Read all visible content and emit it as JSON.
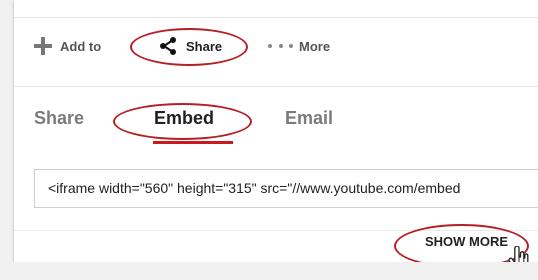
{
  "toolbar": {
    "add_label": "Add to",
    "share_label": "Share",
    "more_label": "More"
  },
  "tabs": [
    {
      "label": "Share"
    },
    {
      "label": "Embed",
      "active": true
    },
    {
      "label": "Email"
    }
  ],
  "embed": {
    "code_text": "<iframe width=\"560\" height=\"315\" src=\"//www.youtube.com/embed"
  },
  "show_more_label": "SHOW MORE",
  "icons": {
    "add": "plus-icon",
    "share": "share-icon",
    "more": "more-dots-icon",
    "pointer": "hand-pointer-icon"
  },
  "colors": {
    "highlight_ring": "#b52026",
    "active_tab_underline": "#cc181e",
    "panel_background": "#f1f1f1"
  }
}
